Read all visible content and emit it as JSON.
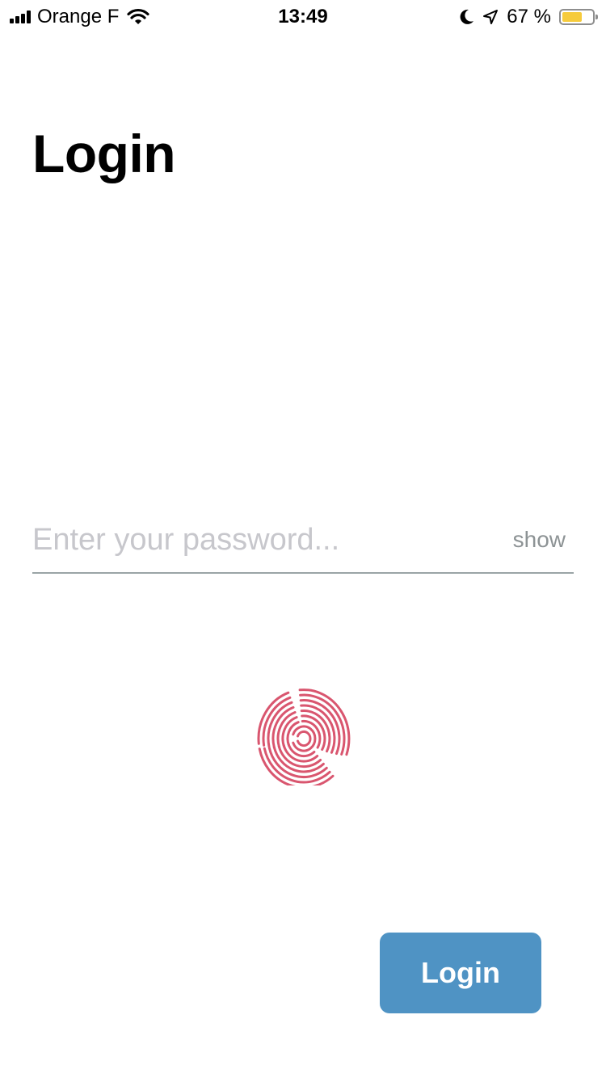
{
  "status_bar": {
    "carrier": "Orange F",
    "time": "13:49",
    "battery_text": "67 %",
    "battery_level": 0.67,
    "battery_color": "#f6cb3c",
    "icons": [
      "signal-icon",
      "wifi-icon",
      "moon-icon",
      "location-arrow-icon",
      "battery-icon"
    ]
  },
  "page": {
    "title": "Login"
  },
  "password": {
    "value": "",
    "placeholder": "Enter your password...",
    "toggle_label": "show"
  },
  "biometric": {
    "icon": "fingerprint-icon",
    "color": "#d9566f"
  },
  "actions": {
    "login_label": "Login",
    "login_color": "#4f93c4"
  }
}
